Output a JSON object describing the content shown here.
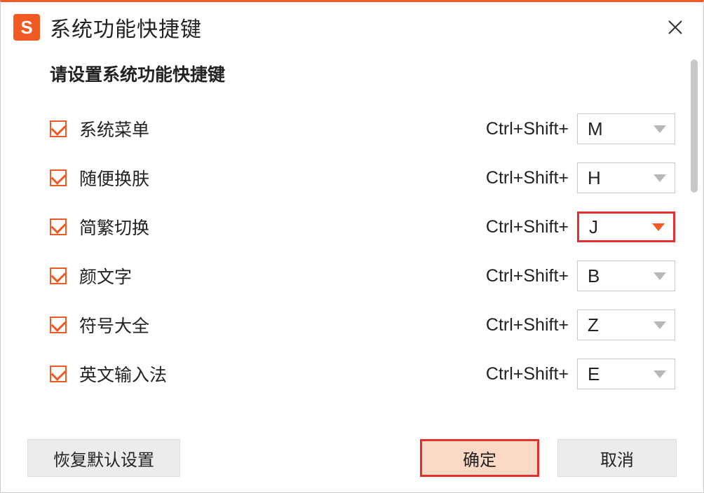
{
  "window": {
    "title": "系统功能快捷键",
    "logo_letter": "S"
  },
  "subtitle": "请设置系统功能快捷键",
  "prefix": "Ctrl+Shift+",
  "rows": [
    {
      "label": "系统菜单",
      "key": "M",
      "highlight": false
    },
    {
      "label": "随便换肤",
      "key": "H",
      "highlight": false
    },
    {
      "label": "简繁切换",
      "key": "J",
      "highlight": true
    },
    {
      "label": "颜文字",
      "key": "B",
      "highlight": false
    },
    {
      "label": "符号大全",
      "key": "Z",
      "highlight": false
    },
    {
      "label": "英文输入法",
      "key": "E",
      "highlight": false
    }
  ],
  "buttons": {
    "restore_default": "恢复默认设置",
    "ok": "确定",
    "cancel": "取消"
  }
}
